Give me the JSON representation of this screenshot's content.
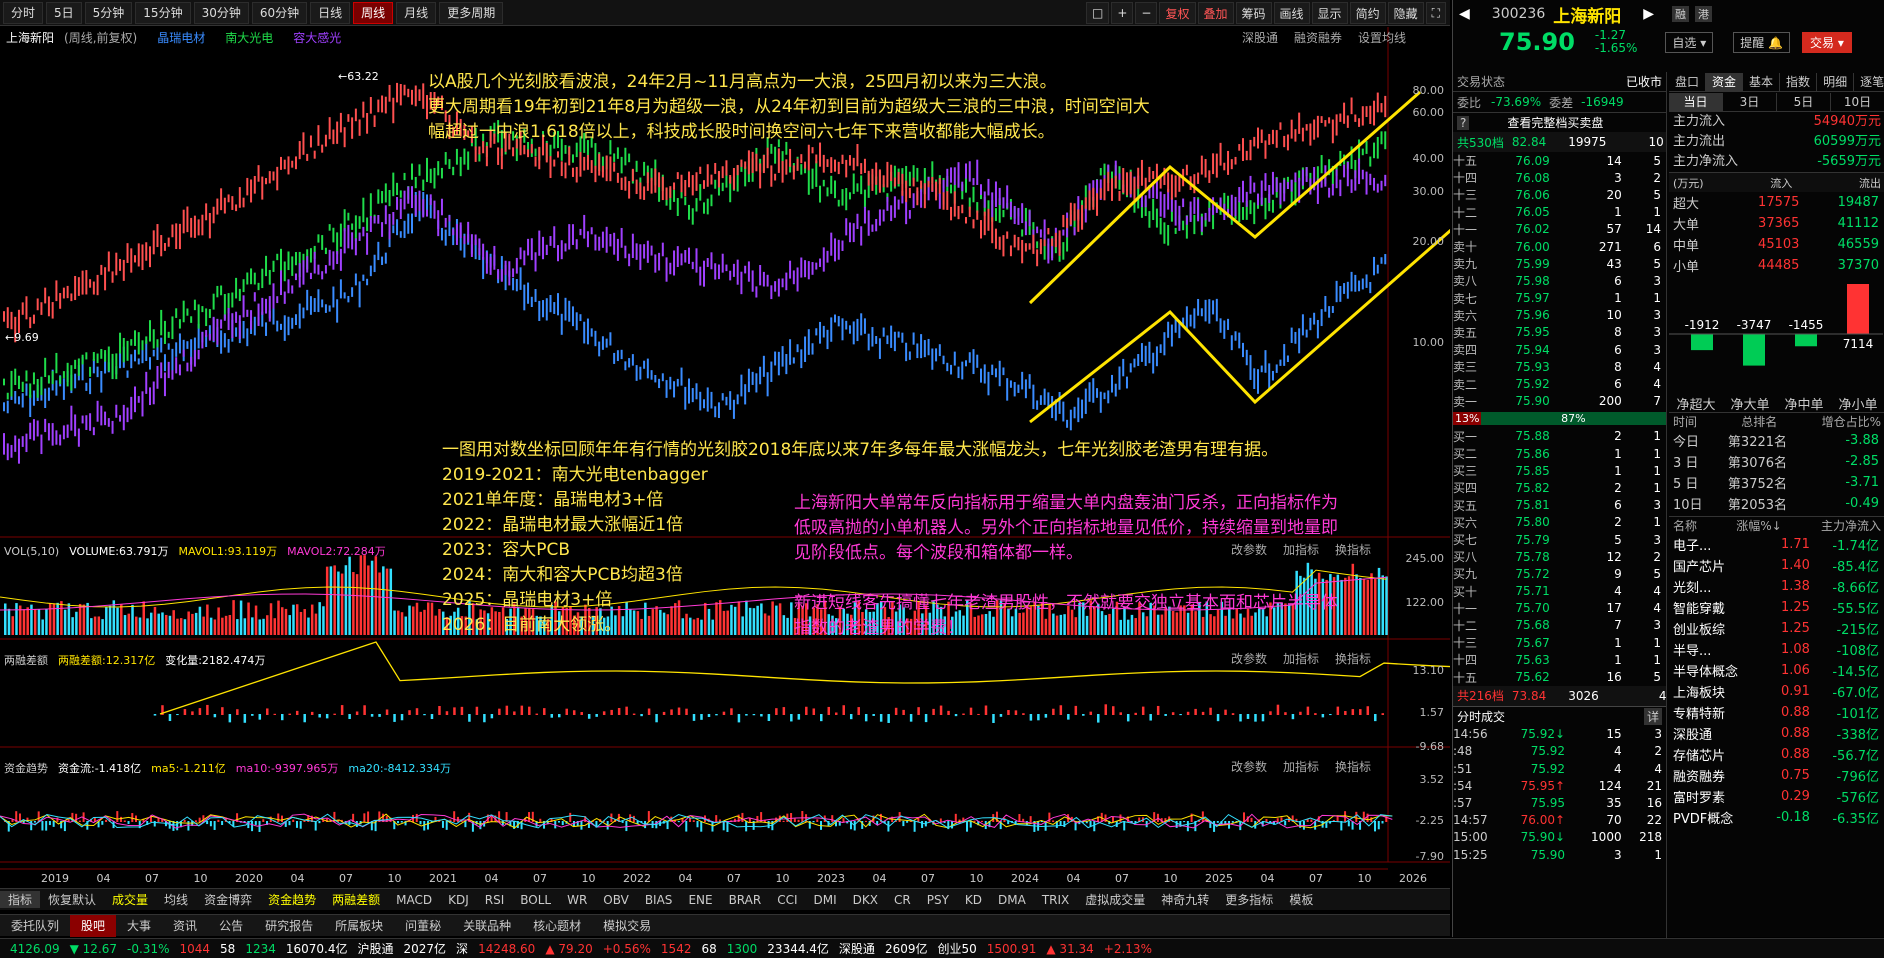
{
  "toolbar": {
    "periods": [
      "分时",
      "5日",
      "5分钟",
      "15分钟",
      "30分钟",
      "60分钟",
      "日线",
      "周线",
      "月线",
      "更多周期"
    ],
    "active": "周线",
    "right": [
      "复权",
      "叠加",
      "筹码",
      "画线",
      "显示",
      "简约",
      "隐藏"
    ]
  },
  "chart": {
    "stock_name": "上海新阳",
    "period_note": "(周线,前复权)",
    "overlays": [
      "晶瑞电材",
      "南大光电",
      "容大感光"
    ],
    "overlay_colors": [
      "#3a8cff",
      "#1fdc4a",
      "#a040ff"
    ],
    "top_right": [
      "深股通",
      "融资融券",
      "设置均线"
    ],
    "high_label": "63.22",
    "low_label": "9.69",
    "y_ticks": [
      "80.00",
      "60.00",
      "40.00",
      "30.00",
      "20.00",
      "10.00"
    ],
    "x_ticks": [
      "2019",
      "04",
      "07",
      "10",
      "2020",
      "04",
      "07",
      "10",
      "2021",
      "04",
      "07",
      "10",
      "2022",
      "04",
      "07",
      "10",
      "2023",
      "04",
      "07",
      "10",
      "2024",
      "04",
      "07",
      "10",
      "2025",
      "04",
      "07",
      "10",
      "2026"
    ],
    "annotation_top": [
      "以A股几个光刻胶看波浪，24年2月~11月高点为一大浪，25四月初以来为三大浪。",
      "更大周期看19年初到21年8月为超级一浪，从24年初到目前为超级大三浪的三中浪，时间空间大",
      "幅超过一中浪1.618倍以上，科技成长股时间换空间六七年下来营收都能大幅成长。"
    ],
    "annotation_mid": [
      "一图用对数坐标回顾年年有行情的光刻胶2018年底以来7年多每年最大涨幅龙头，七年光刻胶老渣男有理有据。",
      "2019-2021：南大光电tenbagger",
      "2021单年度：晶瑞电材3+倍",
      "2022：晶瑞电材最大涨幅近1倍",
      "2023：容大PCB",
      "2024：南大和容大PCB均超3倍",
      "2025：晶瑞电材3+倍",
      "2026：目前南大领涨。"
    ],
    "annotation_pink1": [
      "上海新阳大单常年反向指标用于缩量大单内盘轰油门反杀，正向指标作为",
      "低吸高抛的小单机器人。另外个正向指标地量见低价，持续缩量到地量即",
      "见阶段低点。每个波段和箱体都一样。"
    ],
    "annotation_pink2": [
      "新进短线客先搞懂七年老渣男股性，不然就要交独立基本面和芯片半导体",
      "指数的老渣男的学费！"
    ]
  },
  "vol": {
    "title": "VOL(5,10)",
    "vol": "VOLUME:63.791万",
    "m1": "MAVOL1:93.119万",
    "m2": "MAVOL2:72.284万",
    "ticks": [
      "245.00",
      "122.00"
    ]
  },
  "rz": {
    "title": "两融差额",
    "v1": "两融差额:12.317亿",
    "v2": "变化量:2182.474万",
    "ticks": [
      "13.10",
      "1.57",
      "-9.68"
    ]
  },
  "zj": {
    "title": "资金趋势",
    "v1": "资金流:-1.418亿",
    "v2": "ma5:-1.211亿",
    "v3": "ma10:-9397.965万",
    "v4": "ma20:-8412.334万",
    "ticks": [
      "3.52",
      "-2.25",
      "-7.90"
    ]
  },
  "panel_ctl": [
    "改参数",
    "加指标",
    "换指标"
  ],
  "indicator_tabs": [
    "指标",
    "恢复默认",
    "成交量",
    "均线",
    "资金博弈",
    "资金趋势",
    "两融差额",
    "MACD",
    "KDJ",
    "RSI",
    "BOLL",
    "WR",
    "OBV",
    "BIAS",
    "ENE",
    "BRAR",
    "CCI",
    "DMI",
    "DKX",
    "CR",
    "PSY",
    "KD",
    "DMA",
    "TRIX",
    "虚拟成交量",
    "神奇九转",
    "更多指标",
    "模板"
  ],
  "nav_tabs": [
    "委托队列",
    "股吧",
    "大事",
    "资讯",
    "公告",
    "研究报告",
    "所属板块",
    "问董秘",
    "关联品种",
    "核心题材",
    "模拟交易"
  ],
  "nav_active": "股吧",
  "status": [
    {
      "t": "4126.09",
      "c": "grn"
    },
    {
      "t": "▼ 12.67",
      "c": "grn"
    },
    {
      "t": "-0.31%",
      "c": "grn"
    },
    {
      "t": "1044",
      "c": "red"
    },
    {
      "t": "58",
      "c": "wht"
    },
    {
      "t": "1234",
      "c": "grn"
    },
    {
      "t": "16070.4亿",
      "c": "wht"
    },
    {
      "t": "沪股通",
      "c": "wht"
    },
    {
      "t": "2027亿",
      "c": "wht"
    },
    {
      "t": "深",
      "c": "wht"
    },
    {
      "t": "14248.60",
      "c": "red"
    },
    {
      "t": "▲ 79.20",
      "c": "red"
    },
    {
      "t": "+0.56%",
      "c": "red"
    },
    {
      "t": "1542",
      "c": "red"
    },
    {
      "t": "68",
      "c": "wht"
    },
    {
      "t": "1300",
      "c": "grn"
    },
    {
      "t": "23344.4亿",
      "c": "wht"
    },
    {
      "t": "深股通",
      "c": "wht"
    },
    {
      "t": "2609亿",
      "c": "wht"
    },
    {
      "t": "创业50",
      "c": "wht"
    },
    {
      "t": "1500.91",
      "c": "red"
    },
    {
      "t": "▲ 31.34",
      "c": "red"
    },
    {
      "t": "+2.13%",
      "c": "red"
    }
  ],
  "quote": {
    "code": "300236",
    "name": "上海新阳",
    "tags": [
      "融",
      "港"
    ],
    "price": "75.90",
    "chg": "-1.27",
    "pct": "-1.65%",
    "self": "自选",
    "remind": "提醒",
    "trade": "交易",
    "status_label": "交易状态",
    "status_val": "已收市",
    "weibi_label": "委比",
    "weibi": "-73.69%",
    "weicha_label": "委差",
    "weicha": "-16949",
    "fullbook": "查看完整档买卖盘",
    "sell_total": "共530档",
    "sell_avg": "82.84",
    "sell_vol": "19975",
    "sell_cnt": "10",
    "asks": [
      [
        "十五",
        "76.09",
        "14",
        "5"
      ],
      [
        "十四",
        "76.08",
        "3",
        "2"
      ],
      [
        "十三",
        "76.06",
        "20",
        "5"
      ],
      [
        "十二",
        "76.05",
        "1",
        "1"
      ],
      [
        "十一",
        "76.02",
        "57",
        "14"
      ],
      [
        "卖十",
        "76.00",
        "271",
        "6"
      ],
      [
        "卖九",
        "75.99",
        "43",
        "5"
      ],
      [
        "卖八",
        "75.98",
        "6",
        "3"
      ],
      [
        "卖七",
        "75.97",
        "1",
        "1"
      ],
      [
        "卖六",
        "75.96",
        "10",
        "3"
      ],
      [
        "卖五",
        "75.95",
        "8",
        "3"
      ],
      [
        "卖四",
        "75.94",
        "6",
        "3"
      ],
      [
        "卖三",
        "75.93",
        "8",
        "4"
      ],
      [
        "卖二",
        "75.92",
        "6",
        "4"
      ],
      [
        "卖一",
        "75.90",
        "200",
        "7"
      ]
    ],
    "ratio_left": "13%",
    "ratio_right": "87%",
    "bids": [
      [
        "买一",
        "75.88",
        "2",
        "1"
      ],
      [
        "买二",
        "75.86",
        "1",
        "1"
      ],
      [
        "买三",
        "75.85",
        "1",
        "1"
      ],
      [
        "买四",
        "75.82",
        "2",
        "1"
      ],
      [
        "买五",
        "75.81",
        "6",
        "3"
      ],
      [
        "买六",
        "75.80",
        "2",
        "1"
      ],
      [
        "买七",
        "75.79",
        "5",
        "3"
      ],
      [
        "买八",
        "75.78",
        "12",
        "2"
      ],
      [
        "买九",
        "75.72",
        "9",
        "5"
      ],
      [
        "买十",
        "75.71",
        "4",
        "4"
      ],
      [
        "十一",
        "75.70",
        "17",
        "4"
      ],
      [
        "十二",
        "75.68",
        "7",
        "3"
      ],
      [
        "十三",
        "75.67",
        "1",
        "1"
      ],
      [
        "十四",
        "75.63",
        "1",
        "1"
      ],
      [
        "十五",
        "75.62",
        "16",
        "5"
      ]
    ],
    "buy_total": "共216档",
    "buy_avg": "73.84",
    "buy_vol": "3026",
    "buy_cnt": "4",
    "ticks_title": "分时成交",
    "ticks_more": "详",
    "ticks": [
      [
        "14:56",
        "75.92",
        "↓",
        "15",
        "3"
      ],
      [
        ":48",
        "75.92",
        "",
        "4",
        "2"
      ],
      [
        ":51",
        "75.92",
        "",
        "4",
        "4"
      ],
      [
        ":54",
        "75.95",
        "↑",
        "124",
        "21"
      ],
      [
        ":57",
        "75.95",
        "",
        "35",
        "16"
      ],
      [
        "14:57",
        "76.00",
        "↑",
        "70",
        "22"
      ],
      [
        "15:00",
        "75.90",
        "↓",
        "1000",
        "218"
      ],
      [
        "15:25",
        "75.90",
        "",
        "3",
        "1"
      ]
    ]
  },
  "flow": {
    "tabs": [
      "盘口",
      "资金",
      "基本",
      "指数",
      "明细",
      "逐笔"
    ],
    "tab_on": "资金",
    "days": [
      "当日",
      "3日",
      "5日",
      "10日"
    ],
    "main_in_label": "主力流入",
    "main_in": "54940万元",
    "main_out_label": "主力流出",
    "main_out": "60599万元",
    "main_net_label": "主力净流入",
    "main_net": "-5659万元",
    "unit": "(万元)",
    "in": "流入",
    "out": "流出",
    "rows": [
      [
        "超大",
        "17575",
        "19487"
      ],
      [
        "大单",
        "37365",
        "41112"
      ],
      [
        "中单",
        "45103",
        "46559"
      ],
      [
        "小单",
        "44485",
        "37370"
      ]
    ],
    "bars": [
      {
        "v": "-1912",
        "n": -1912
      },
      {
        "v": "-3747",
        "n": -3747
      },
      {
        "v": "-1455",
        "n": -1455
      },
      {
        "v": "7114",
        "n": 7114
      }
    ],
    "bar_labels": [
      "净超大",
      "净大单",
      "净中单",
      "净小单"
    ],
    "rank_head": [
      "时间",
      "总排名",
      "增仓占比%"
    ],
    "ranks": [
      [
        "今日",
        "第3221名",
        "-3.88"
      ],
      [
        "3 日",
        "第3076名",
        "-2.85"
      ],
      [
        "5 日",
        "第3752名",
        "-3.71"
      ],
      [
        "10日",
        "第2053名",
        "-0.49"
      ]
    ],
    "sector_head": [
      "名称",
      "涨幅%↓",
      "主力净流入"
    ],
    "sectors": [
      [
        "电子...",
        "1.71",
        "-1.74亿"
      ],
      [
        "国产芯片",
        "1.40",
        "-85.4亿"
      ],
      [
        "光刻...",
        "1.38",
        "-8.66亿"
      ],
      [
        "智能穿戴",
        "1.25",
        "-55.5亿"
      ],
      [
        "创业板综",
        "1.25",
        "-215亿"
      ],
      [
        "半导...",
        "1.08",
        "-108亿"
      ],
      [
        "半导体概念",
        "1.06",
        "-14.5亿"
      ],
      [
        "上海板块",
        "0.91",
        "-67.0亿"
      ],
      [
        "专精特新",
        "0.88",
        "-101亿"
      ],
      [
        "深股通",
        "0.88",
        "-338亿"
      ],
      [
        "存储芯片",
        "0.88",
        "-56.7亿"
      ],
      [
        "融资融券",
        "0.75",
        "-796亿"
      ],
      [
        "富时罗素",
        "0.29",
        "-576亿"
      ],
      [
        "PVDF概念",
        "-0.18",
        "-6.35亿"
      ]
    ]
  }
}
